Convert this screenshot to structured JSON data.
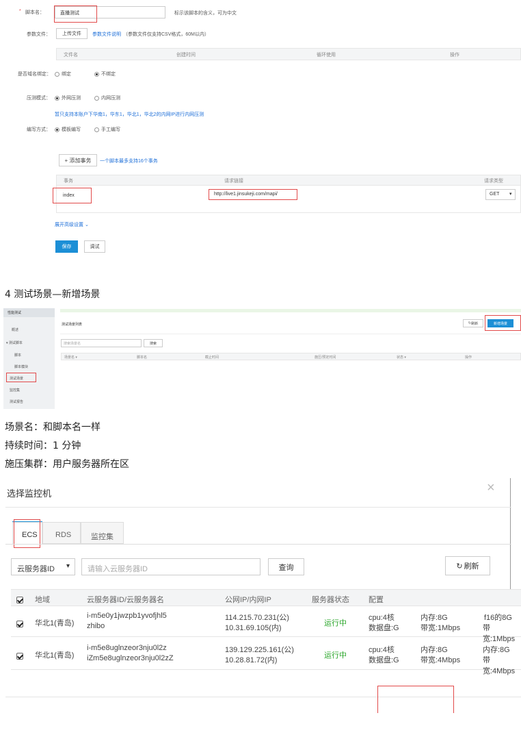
{
  "form": {
    "script_name_label": "脚本名：",
    "script_name_value": "直播测试",
    "script_name_hint": "标示该脚本的含义，可为中文",
    "param_file_label": "参数文件：",
    "upload_button": "上传文件",
    "param_doc_link": "参数文件说明",
    "param_doc_note": "（参数文件仅支持CSV格式，60M以内）",
    "file_table_headers": [
      "文件名",
      "创建时间",
      "循环使用",
      "操作"
    ],
    "domain_bind_label": "是否域名绑定：",
    "domain_bind_options": [
      "绑定",
      "不绑定"
    ],
    "mode_label": "压测模式：",
    "mode_options": [
      "外网压测",
      "内网压测"
    ],
    "mode_notice": "暂只支持本账户下华南1，华东1，华北1，华北2的内网IP进行内网压测",
    "write_label": "编写方式：",
    "write_options": [
      "模板编写",
      "手工编写"
    ],
    "add_tx_button": "+ 添加事务",
    "add_tx_hint": "一个脚本最多支持16个事务",
    "tx_headers": [
      "事务",
      "请求链接",
      "请求类型"
    ],
    "tx_name": "index",
    "tx_url": "http://live1.jinsukeji.com/mapi/",
    "tx_method": "GET",
    "advanced_link": "展开高级设置",
    "save_button": "保存",
    "debug_button": "调试"
  },
  "doc": {
    "section_heading": "4 测试场景—新增场景",
    "lines": [
      "场景名：和脚本名一样",
      "持续时间：1 分钟",
      "施压集群：用户服务器所在区"
    ]
  },
  "scene": {
    "sidebar": [
      "性能测试",
      "概述",
      "测试脚本",
      "脚本",
      "脚本模块",
      "测试场景",
      "监控集",
      "测试报告"
    ],
    "title": "测试场景列表",
    "refresh_button": "刷新",
    "new_button": "新增场景",
    "search_placeholder": "搜索场景名",
    "search_button": "搜索",
    "headers": [
      "场景名",
      "脚本名",
      "截止时间",
      "施压/预定时间",
      "状态",
      "操作"
    ]
  },
  "monitor": {
    "title": "选择监控机",
    "tabs": [
      "ECS",
      "RDS",
      "监控集"
    ],
    "select_value": "云服务器ID",
    "search_placeholder": "请输入云服务器ID",
    "query_button": "查询",
    "refresh_button": "刷新",
    "headers": [
      "地域",
      "云服务器ID/云服务器名",
      "公网IP/内网IP",
      "服务器状态",
      "配置"
    ],
    "rows": [
      {
        "region": "华北1(青岛)",
        "id": "i-m5e0y1jwzpb1yvofjhl5",
        "name": "zhibo",
        "public_ip": "114.215.70.231(公)",
        "private_ip": "10.31.69.105(内)",
        "status": "运行中",
        "cpu": "cpu:4核",
        "disk": "数据盘:G",
        "mem": "内存:8G",
        "bw": "带宽:1Mbps",
        "mem2": "f16的8G",
        "bw2": "带宽:1Mbps"
      },
      {
        "region": "华北1(青岛)",
        "id": "i-m5e8uglnzeor3nju0l2z",
        "name": "iZm5e8uglnzeor3nju0l2zZ",
        "public_ip": "139.129.225.161(公)",
        "private_ip": "10.28.81.72(内)",
        "status": "运行中",
        "cpu": "cpu:4核",
        "disk": "数据盘:G",
        "mem": "内存:8G",
        "bw": "带宽:4Mbps",
        "mem2": "内存:8G",
        "bw2": "带宽:4Mbps"
      }
    ]
  },
  "colors": {
    "accent": "#1c8fd6",
    "link": "#1e6fd8",
    "running": "#2aa62a",
    "highlight": "#e24a4a"
  }
}
